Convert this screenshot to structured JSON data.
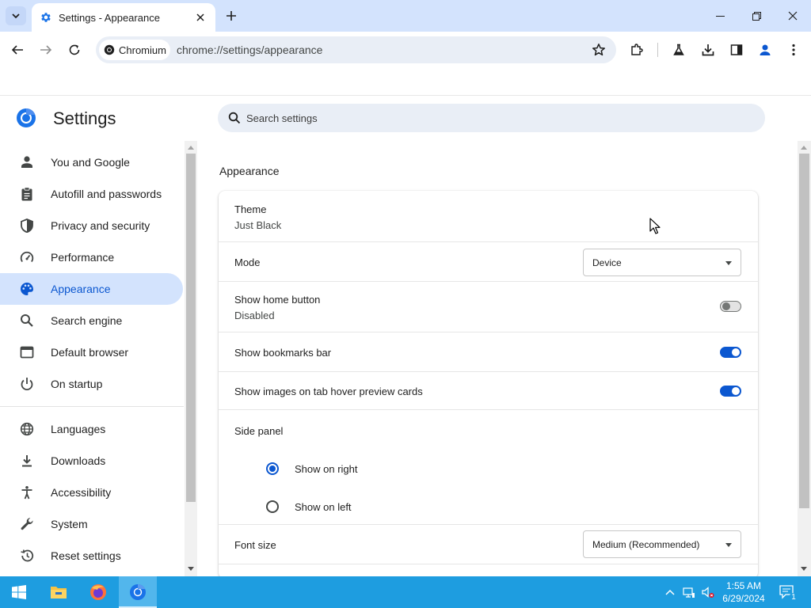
{
  "tab": {
    "title": "Settings - Appearance",
    "icon": "gear-icon"
  },
  "omnibox": {
    "chip_label": "Chromium",
    "url": "chrome://settings/appearance"
  },
  "settings": {
    "title": "Settings",
    "search_placeholder": "Search settings"
  },
  "sidebar": {
    "items": [
      {
        "label": "You and Google",
        "icon": "person-icon",
        "active": false
      },
      {
        "label": "Autofill and passwords",
        "icon": "clipboard-icon",
        "active": false
      },
      {
        "label": "Privacy and security",
        "icon": "shield-icon",
        "active": false
      },
      {
        "label": "Performance",
        "icon": "speedometer-icon",
        "active": false
      },
      {
        "label": "Appearance",
        "icon": "palette-icon",
        "active": true
      },
      {
        "label": "Search engine",
        "icon": "search-icon",
        "active": false
      },
      {
        "label": "Default browser",
        "icon": "browser-window-icon",
        "active": false
      },
      {
        "label": "On startup",
        "icon": "power-icon",
        "active": false
      },
      {
        "label": "Languages",
        "icon": "globe-icon",
        "active": false
      },
      {
        "label": "Downloads",
        "icon": "download-icon",
        "active": false
      },
      {
        "label": "Accessibility",
        "icon": "accessibility-icon",
        "active": false
      },
      {
        "label": "System",
        "icon": "wrench-icon",
        "active": false
      },
      {
        "label": "Reset settings",
        "icon": "history-icon",
        "active": false
      }
    ]
  },
  "appearance": {
    "section_title": "Appearance",
    "theme": {
      "label": "Theme",
      "value": "Just Black"
    },
    "mode": {
      "label": "Mode",
      "value": "Device"
    },
    "home_button": {
      "label": "Show home button",
      "value": "Disabled",
      "enabled": false
    },
    "bookmarks_bar": {
      "label": "Show bookmarks bar",
      "enabled": true
    },
    "hover_cards": {
      "label": "Show images on tab hover preview cards",
      "enabled": true
    },
    "side_panel": {
      "label": "Side panel",
      "options": [
        {
          "label": "Show on right",
          "checked": true
        },
        {
          "label": "Show on left",
          "checked": false
        }
      ]
    },
    "font_size": {
      "label": "Font size",
      "value": "Medium (Recommended)"
    }
  },
  "taskbar": {
    "time": "1:55 AM",
    "date": "6/29/2024",
    "notification_count": "1",
    "apps": [
      "windows-start-icon",
      "file-explorer-icon",
      "firefox-icon",
      "chromium-icon"
    ]
  },
  "colors": {
    "accent": "#0b57d0",
    "tabstrip_bg": "#d3e3fd",
    "taskbar_bg": "#1e9de0"
  }
}
